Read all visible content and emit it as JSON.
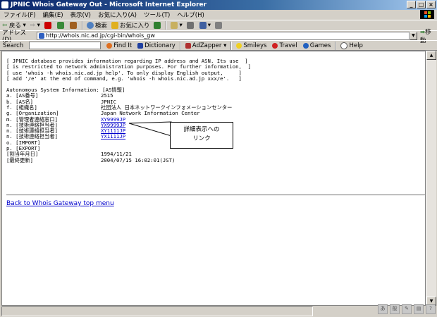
{
  "window": {
    "title": "JPNIC Whois Gateway Out - Microsoft Internet Explorer"
  },
  "menu": [
    "ファイル(F)",
    "編集(E)",
    "表示(V)",
    "お気に入り(A)",
    "ツール(T)",
    "ヘルプ(H)"
  ],
  "toolbar": {
    "back": "戻る",
    "search": "検索",
    "favorites": "お気に入り"
  },
  "address": {
    "label": "アドレス(D)",
    "url": "http://whois.nic.ad.jp/cgi-bin/whois_gw",
    "go": "移動"
  },
  "links": {
    "search_label": "Search",
    "findit": "Find It",
    "dictionary": "Dictionary",
    "adzapper": "AdZapper",
    "smileys": "Smileys",
    "travel": "Travel",
    "games": "Games",
    "help": "Help"
  },
  "page": {
    "notice": [
      "[ JPNIC database provides information regarding IP address and ASN. Its use  ]",
      "[ is restricted to network administration purposes. For further information,  ]",
      "[ use 'whois -h whois.nic.ad.jp help'. To only display English output,     ]",
      "[ add '/e' at the end of command, e.g. 'whois -h whois.nic.ad.jp xxx/e'.   ]"
    ],
    "section_title": "Autonomous System Information: [AS情報]",
    "records": [
      {
        "key": "a. [AS番号]",
        "value": "2515",
        "link": false
      },
      {
        "key": "b. [AS名]",
        "value": "JPNIC",
        "link": false
      },
      {
        "key": "f. [組織名]",
        "value": "社団法人 日本ネットワークインフォメーションセンター",
        "link": false
      },
      {
        "key": "g. [Organization]",
        "value": "Japan Network Information Center",
        "link": false
      },
      {
        "key": "m. [管理者連絡窓口]",
        "value": "XY9999JP",
        "link": true
      },
      {
        "key": "n. [技術連絡担当者]",
        "value": "YX9999JP",
        "link": true
      },
      {
        "key": "n. [技術連絡担当者]",
        "value": "XY1111JP",
        "link": true
      },
      {
        "key": "n. [技術連絡担当者]",
        "value": "YX1111JP",
        "link": true
      },
      {
        "key": "o. [IMPORT]",
        "value": "",
        "link": false
      },
      {
        "key": "p. [EXPORT]",
        "value": "",
        "link": false
      },
      {
        "key": "[割当年月日]",
        "value": "1994/11/21",
        "link": false
      },
      {
        "key": "[最終更新]",
        "value": "2004/07/15 16:02:01(JST)",
        "link": false
      }
    ],
    "callout": [
      "詳細表示への",
      "リンク"
    ],
    "top_link": "Back to Whois Gateway top menu"
  },
  "colors": {
    "title_start": "#0a246a",
    "title_end": "#a6caf0",
    "link": "#0000cc"
  }
}
